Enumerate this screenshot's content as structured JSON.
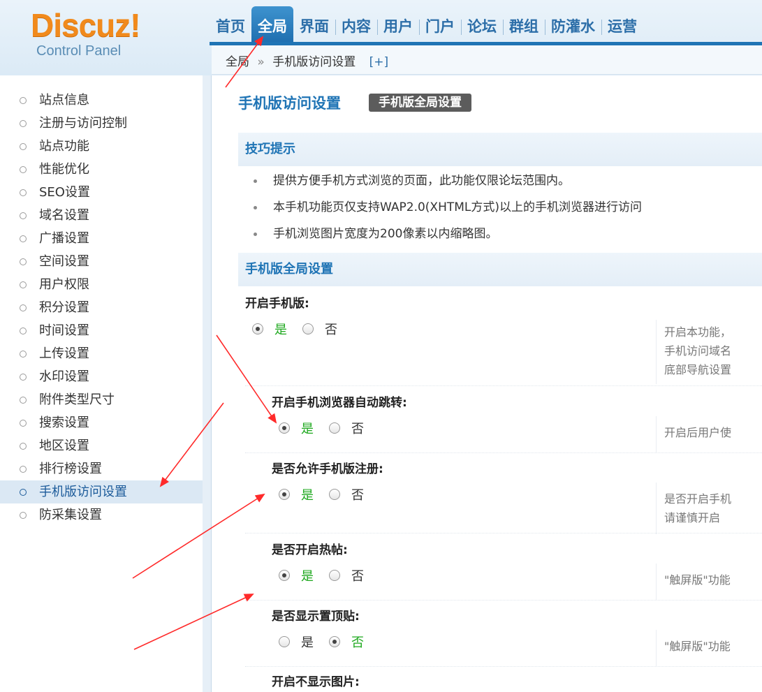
{
  "logo": {
    "brand": "Discuz!",
    "subtitle": "Control Panel"
  },
  "nav": {
    "tabs": [
      "首页",
      "全局",
      "界面",
      "内容",
      "用户",
      "门户",
      "论坛",
      "群组",
      "防灌水",
      "运营"
    ]
  },
  "breadcrumb": {
    "root": "全局",
    "separator": "»",
    "current": "手机版访问设置",
    "add": "[+]"
  },
  "sidebar": {
    "items": [
      "站点信息",
      "注册与访问控制",
      "站点功能",
      "性能优化",
      "SEO设置",
      "域名设置",
      "广播设置",
      "空间设置",
      "用户权限",
      "积分设置",
      "时间设置",
      "上传设置",
      "水印设置",
      "附件类型尺寸",
      "搜索设置",
      "地区设置",
      "排行榜设置",
      "手机版访问设置",
      "防采集设置"
    ],
    "active_index": 17
  },
  "main": {
    "title": "手机版访问设置",
    "title_button": "手机版全局设置",
    "tips_heading": "技巧提示",
    "tips": [
      "提供方便手机方式浏览的页面，此功能仅限论坛范围内。",
      "本手机功能页仅支持WAP2.0(XHTML方式)以上的手机浏览器进行访问",
      "手机浏览图片宽度为200像素以内缩略图。"
    ],
    "settings_heading": "手机版全局设置",
    "settings": [
      {
        "label": "开启手机版:",
        "yes": "是",
        "no": "否",
        "selected": "yes",
        "desc": [
          "开启本功能，",
          "手机访问域名",
          "底部导航设置"
        ]
      },
      {
        "label": "开启手机浏览器自动跳转:",
        "yes": "是",
        "no": "否",
        "selected": "yes",
        "desc": [
          "开启后用户使"
        ]
      },
      {
        "label": "是否允许手机版注册:",
        "yes": "是",
        "no": "否",
        "selected": "yes",
        "desc": [
          "是否开启手机",
          "请谨慎开启"
        ]
      },
      {
        "label": "是否开启热帖:",
        "yes": "是",
        "no": "否",
        "selected": "yes",
        "desc": [
          "\"触屏版\"功能"
        ]
      },
      {
        "label": "是否显示置顶贴:",
        "yes": "是",
        "no": "否",
        "selected": "no",
        "desc": [
          "\"触屏版\"功能"
        ]
      },
      {
        "label": "开启不显示图片:"
      }
    ]
  },
  "colors": {
    "accent": "#1f74b5",
    "brand": "#f18a1c",
    "checked": "#1ea81e",
    "annotation": "#ff2a2a"
  }
}
